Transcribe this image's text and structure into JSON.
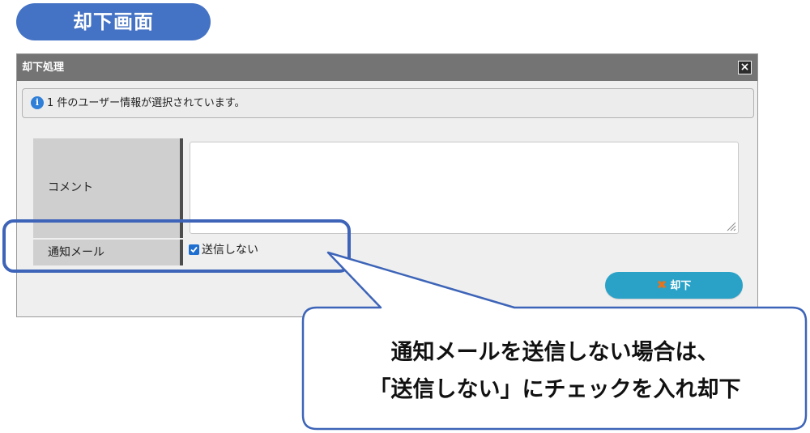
{
  "header": {
    "title": "却下画面"
  },
  "dialog": {
    "title": "却下処理",
    "close_icon": "close-icon",
    "info": {
      "icon": "info-icon",
      "icon_glyph": "i",
      "text": "1 件のユーザー情報が選択されています。"
    },
    "form": {
      "comment_label": "コメント",
      "comment_value": "",
      "notify_label": "通知メール",
      "notify_option_label": "送信しない",
      "notify_option_checked": true
    },
    "reject_button": {
      "icon": "x-icon",
      "icon_glyph": "✖",
      "label": "却下"
    }
  },
  "callout": {
    "line1": "通知メールを送信しない場合は、",
    "line2": "「送信しない」にチェックを入れ却下"
  },
  "colors": {
    "title_pill": "#4472c4",
    "titlebar": "#747474",
    "reject_button": "#2aa2c8",
    "highlight": "#3d64b8"
  }
}
